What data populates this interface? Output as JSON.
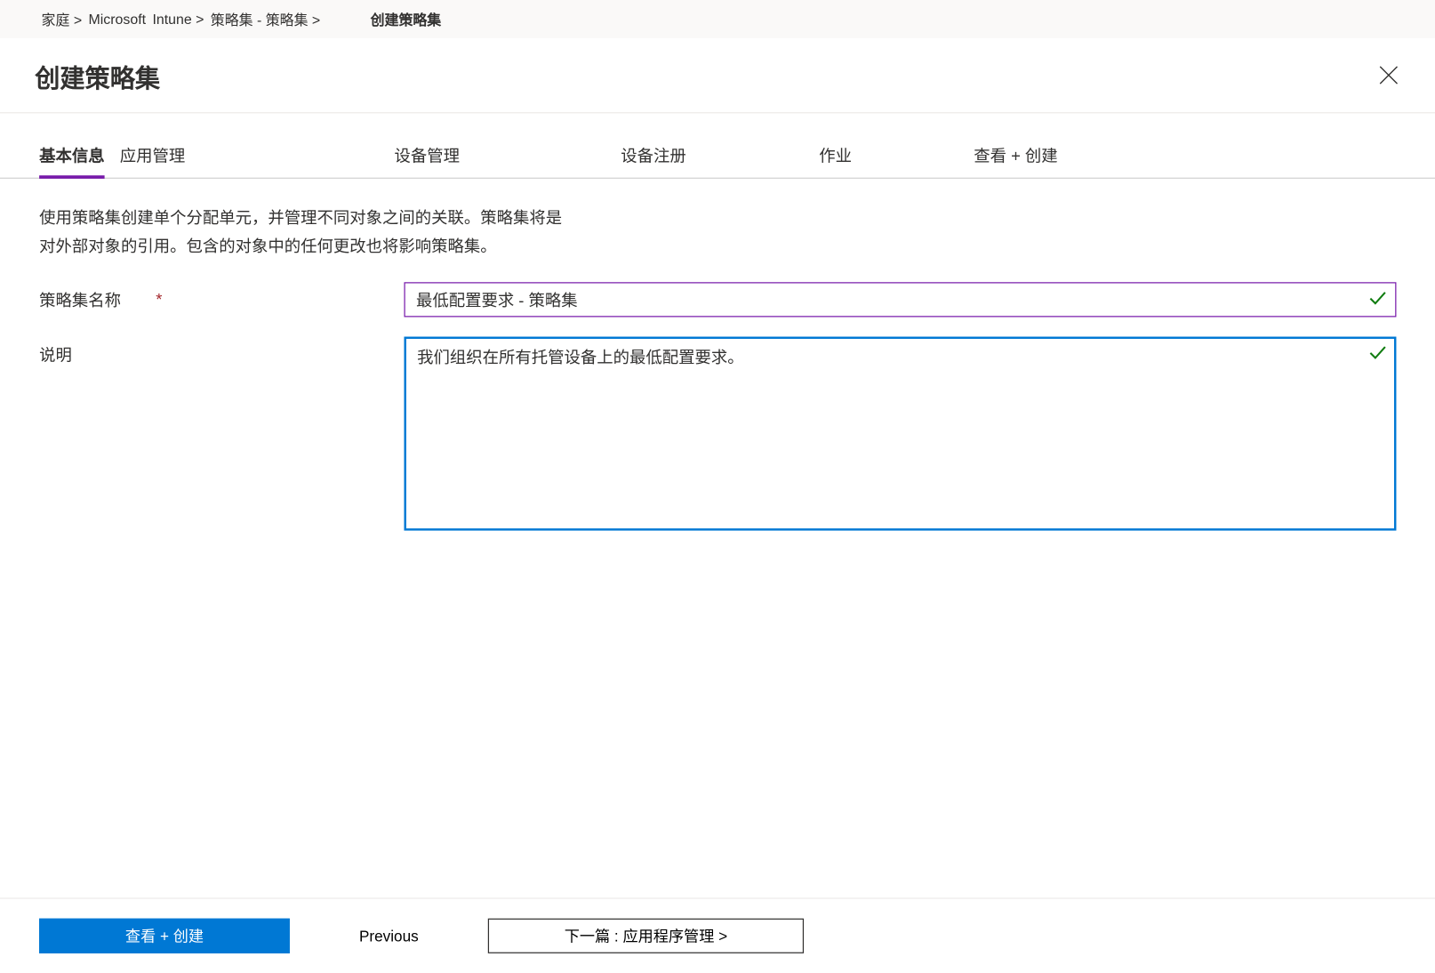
{
  "breadcrumb": {
    "home": "家庭 &gt;",
    "ms": "Microsoft",
    "intune": "Intune &gt;",
    "policy_sets": "策略集 - 策略集 &gt;",
    "current": "创建策略集"
  },
  "page_title": "创建策略集",
  "tabs": {
    "basics": "基本信息",
    "app_mgmt": "应用管理",
    "device_mgmt": "设备管理",
    "device_enroll": "设备注册",
    "assignments": "作业",
    "review": "查看 + 创建"
  },
  "description_line1": "使用策略集创建单个分配单元，并管理不同对象之间的关联。策略集将是",
  "description_line2": "对外部对象的引用。包含的对象中的任何更改也将影响策略集。",
  "form": {
    "name_label": "策略集名称",
    "name_value": "最低配置要求 - 策略集",
    "desc_label": "说明",
    "desc_value": "我们组织在所有托管设备上的最低配置要求。"
  },
  "footer": {
    "review_create": "查看 + 创建",
    "previous": "Previous",
    "next": "下一篇 : 应用程序管理 &gt;"
  }
}
